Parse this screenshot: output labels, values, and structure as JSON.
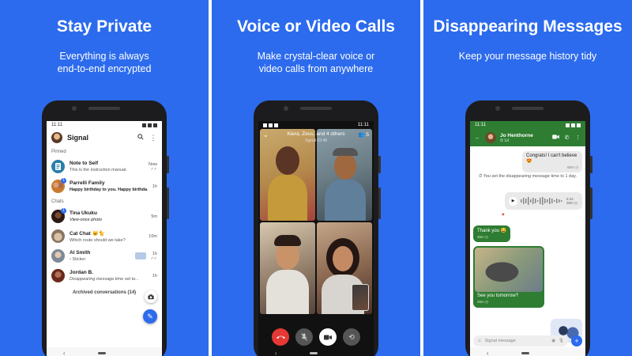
{
  "panels": [
    {
      "headline": "Stay Private",
      "subline": [
        "Everything is always",
        "end-to-end encrypted"
      ]
    },
    {
      "headline": "Voice or Video Calls",
      "subline": [
        "Make crystal-clear voice or",
        "video calls from anywhere"
      ]
    },
    {
      "headline": "Disappearing Messages",
      "subline": [
        "Keep your message history tidy"
      ]
    }
  ],
  "status_time": "11:11",
  "chat_list": {
    "app_title": "Signal",
    "pinned_label": "Pinned",
    "chats_label": "Chats",
    "pinned": [
      {
        "name": "Note to Self",
        "preview": "This is the instruction manual.",
        "time": "Now"
      },
      {
        "name": "Parrelli Family",
        "preview": "Happy birthday to you. Happy birthda...",
        "time": "1h"
      }
    ],
    "chats": [
      {
        "name": "Tina Ukuku",
        "preview": "View-once photo",
        "time": "5m"
      },
      {
        "name": "Cat Chat 🐱🐈",
        "preview": "Which route should we take?",
        "time": "10m"
      },
      {
        "name": "Al Smith",
        "preview": "Sticker",
        "time": "1h"
      },
      {
        "name": "Jordan B.",
        "preview": "Disappearing message time set to...",
        "time": "1h"
      }
    ],
    "archived": "Archived conversations (14)"
  },
  "call": {
    "title": "Kiera, Zeus, and 4 others",
    "subtitle": "Signal 03:48",
    "participants": "5"
  },
  "conversation": {
    "contact": "Jo Henthorne",
    "timer": "1d",
    "messages": {
      "congrats": "Congrats! I can't believe 😍",
      "congrats_meta": "55m",
      "system": "You set the disappearing message time to 1 day.",
      "voice_len": "5:42",
      "voice_meta": "36m",
      "thank_you": "Thank you 😄",
      "thank_you_meta": "25m",
      "see_you": "See you tomorrow?",
      "see_you_meta": "25m"
    },
    "composer_placeholder": "Signal message"
  },
  "colors": {
    "brand_blue": "#2c6bed",
    "green": "#2e7d32",
    "end_call_red": "#e53935"
  }
}
